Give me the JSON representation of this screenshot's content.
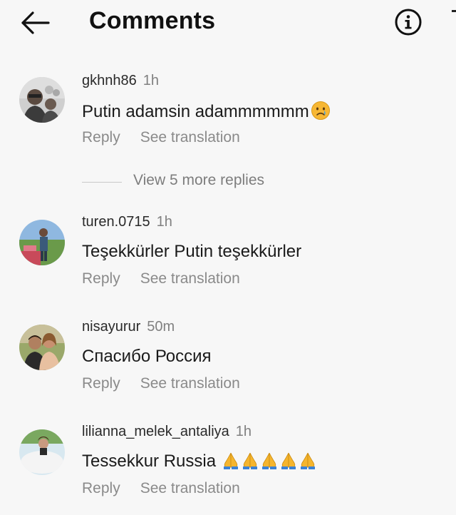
{
  "header": {
    "title": "Comments"
  },
  "comments": [
    {
      "username": "gkhnh86",
      "time": "1h",
      "text": "Putin adamsin adammmmmm",
      "emoji": "crying-face-icon",
      "reply_label": "Reply",
      "translate_label": "See translation"
    },
    {
      "username": "turen.0715",
      "time": "1h",
      "text": "Teşekkürler Putin teşekkürler",
      "reply_label": "Reply",
      "translate_label": "See translation"
    },
    {
      "username": "nisayurur",
      "time": "50m",
      "text": "Спасибо Россия",
      "reply_label": "Reply",
      "translate_label": "See translation"
    },
    {
      "username": "lilianna_melek_antaliya",
      "time": "1h",
      "text": "Tessekkur Russia",
      "emoji": "folded-hands-icon",
      "emoji_count": 5,
      "reply_label": "Reply",
      "translate_label": "See translation"
    }
  ],
  "view_more_replies": "View 5 more replies",
  "colors": {
    "background": "#f7f7f7",
    "text": "#111111",
    "muted": "#8a8a8a",
    "emoji_yellow": "#f7b733"
  }
}
